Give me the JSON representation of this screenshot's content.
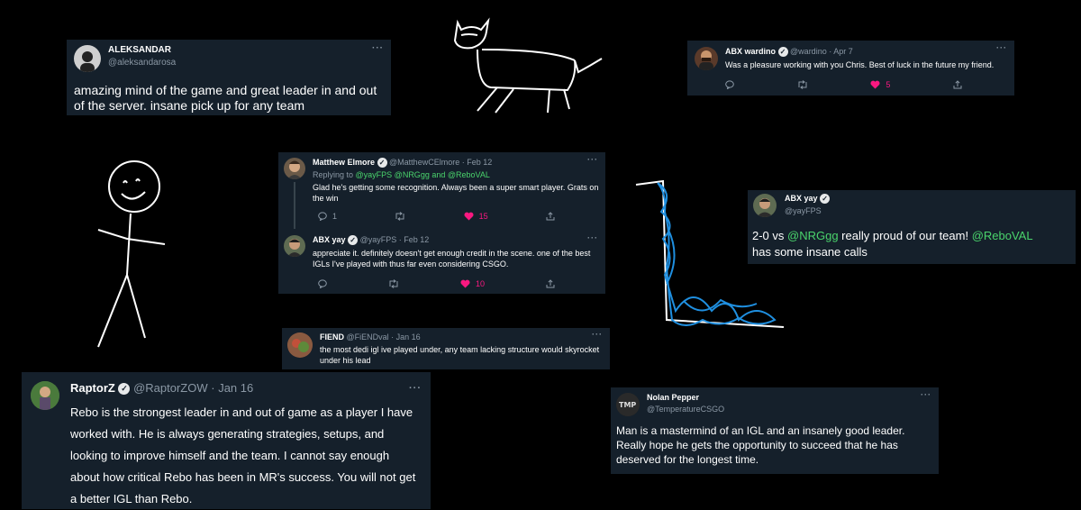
{
  "tweets": {
    "aleksandar": {
      "name": "ALEKSANDAR",
      "handle": "@aleksandarosa",
      "text": "amazing mind of the game and great leader in and out of the server. insane pick up for any team"
    },
    "wardino": {
      "name": "ABX wardino",
      "handle": "@wardino",
      "date": "· Apr 7",
      "text": "Was a pleasure working with you Chris.  Best of luck in the future my friend.",
      "likes": "5"
    },
    "elmore": {
      "name": "Matthew Elmore",
      "handle": "@MatthewCElmore",
      "date": "· Feb 12",
      "reply_prefix": "Replying to ",
      "reply_to": "@yayFPS @NRGgg and @ReboVAL",
      "text": "Glad he's getting some recognition. Always been a super smart player. Grats on the win",
      "replies": "1",
      "likes": "15"
    },
    "yay_reply": {
      "name": "ABX yay",
      "handle": "@yayFPS",
      "date": "· Feb 12",
      "text": "appreciate it. definitely doesn't get enough credit in the scene. one of the best IGLs I've played with thus far even considering CSGO.",
      "likes": "10"
    },
    "yay_main": {
      "name": "ABX yay",
      "handle": "@yayFPS",
      "text_part1": "2-0 vs ",
      "mention1": "@NRGgg",
      "text_part2": " really proud of our team! ",
      "mention2": "@ReboVAL",
      "text_part3": "has some insane calls"
    },
    "fiend": {
      "name": "FIEND",
      "handle": "@FiENDval",
      "date": "· Jan 16",
      "text": "the most dedi igl ive played under, any team lacking structure would skyrocket under his lead"
    },
    "raptorz": {
      "name": "RaptorZ",
      "handle": "@RaptorZOW",
      "date": "· Jan 16",
      "text": "Rebo is the strongest leader in and out of game as a player I have worked with. He is always generating strategies, setups, and looking to improve himself and the team.  I cannot say enough about how critical Rebo has been in MR's success. You will not get a better IGL than Rebo."
    },
    "nolan": {
      "name": "Nolan Pepper",
      "handle": "@TemperatureCSGO",
      "text": "Man is a mastermind of an IGL and an insanely good leader. Really hope he gets the opportunity to succeed that he has deserved for the longest time."
    }
  },
  "icons": {
    "more": "···",
    "reply": "reply-icon",
    "retweet": "retweet-icon",
    "like": "heart-icon",
    "share": "share-icon",
    "verified": "verified-icon"
  },
  "colors": {
    "card_bg": "#15202b",
    "like": "#f91880",
    "link": "#1d9bf0",
    "mention_green": "#4ad46c",
    "scribble_blue": "#1f8fe0"
  }
}
